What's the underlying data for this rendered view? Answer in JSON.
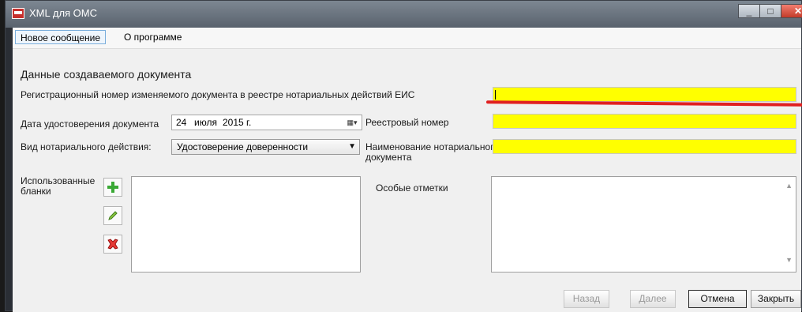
{
  "window": {
    "title": "XML для ОМС",
    "minimize": "_",
    "maximize": "□",
    "close": "✕"
  },
  "menu": {
    "new_message": "Новое сообщение",
    "about": "О программе"
  },
  "form": {
    "section_title": "Данные создаваемого документа",
    "reg_number_label": "Регистрационный номер изменяемого документа в реестре нотариальных действий ЕИС",
    "reg_number_value": "",
    "date_label": "Дата удостоверения документа",
    "date_day": "24",
    "date_month": "июля",
    "date_year": "2015 г.",
    "registry_number_label": "Реестровый номер",
    "registry_number_value": "",
    "action_type_label": "Вид нотариального действия:",
    "action_type_value": "Удостоверение доверенности",
    "doc_name_label_line1": "Наименование нотариального",
    "doc_name_label_line2": "документа",
    "doc_name_value": "",
    "blanks_label_line1": "Использованные",
    "blanks_label_line2": "бланки",
    "notes_label": "Особые отметки"
  },
  "buttons": {
    "back": "Назад",
    "next": "Далее",
    "cancel": "Отмена",
    "close": "Закрыть"
  },
  "colors": {
    "highlight": "#ffff00",
    "underline": "#e02020"
  }
}
